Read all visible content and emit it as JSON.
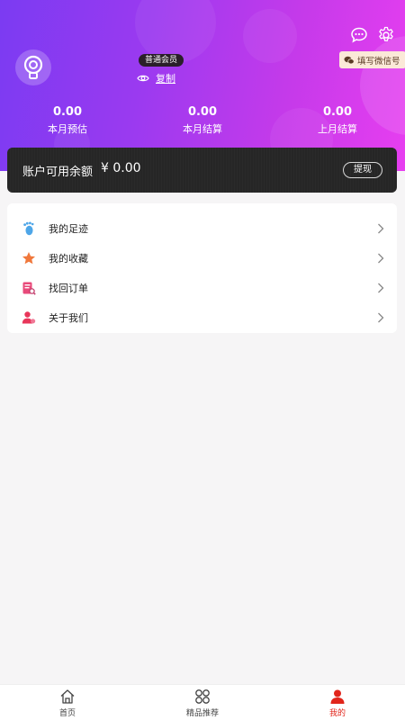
{
  "header": {
    "member_level": "普通会员",
    "copy_label": "复制",
    "wechat_button": "填写微信号",
    "icons": {
      "message": "chat-bubble-icon",
      "settings": "gear-icon",
      "visibility": "eye-icon",
      "wechat": "wechat-icon"
    }
  },
  "stats": [
    {
      "value": "0.00",
      "label": "本月预估"
    },
    {
      "value": "0.00",
      "label": "本月结算"
    },
    {
      "value": "0.00",
      "label": "上月结算"
    }
  ],
  "balance": {
    "label": "账户可用余额",
    "amount": "¥ 0.00",
    "withdraw_label": "提现"
  },
  "menu": [
    {
      "label": "我的足迹",
      "icon": "footprint-icon"
    },
    {
      "label": "我的收藏",
      "icon": "star-icon"
    },
    {
      "label": "找回订单",
      "icon": "order-search-icon"
    },
    {
      "label": "关于我们",
      "icon": "about-us-icon"
    }
  ],
  "tabbar": [
    {
      "label": "首页",
      "icon": "home-icon"
    },
    {
      "label": "精品推荐",
      "icon": "grid-icon"
    },
    {
      "label": "我的",
      "icon": "user-icon",
      "active": true
    }
  ],
  "colors": {
    "gradient_start": "#7b3bf2",
    "gradient_end": "#e73ef0",
    "active_tab": "#e1251b",
    "balance_card": "#262626"
  }
}
